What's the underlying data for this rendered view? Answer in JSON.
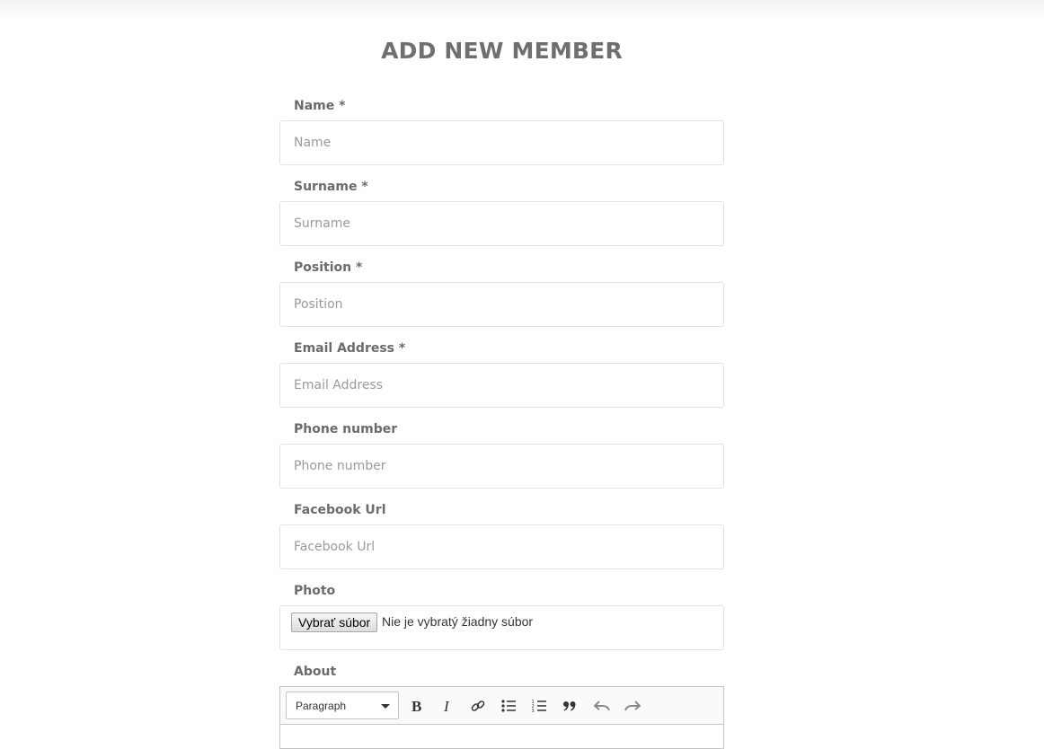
{
  "page": {
    "title": "ADD NEW MEMBER"
  },
  "form": {
    "name": {
      "label": "Name *",
      "placeholder": "Name"
    },
    "surname": {
      "label": "Surname *",
      "placeholder": "Surname"
    },
    "position": {
      "label": "Position *",
      "placeholder": "Position"
    },
    "email": {
      "label": "Email Address *",
      "placeholder": "Email Address"
    },
    "phone": {
      "label": "Phone number",
      "placeholder": "Phone number"
    },
    "facebook": {
      "label": "Facebook Url",
      "placeholder": "Facebook Url"
    },
    "photo": {
      "label": "Photo",
      "button_label": "Vybrať súbor",
      "status": "Nie je vybratý žiadny súbor"
    },
    "about": {
      "label": "About",
      "heading_select": "Paragraph",
      "toolbar": [
        "bold-icon",
        "italic-icon",
        "link-icon",
        "bulleted-list-icon",
        "numbered-list-icon",
        "blockquote-icon",
        "undo-icon",
        "redo-icon"
      ]
    }
  }
}
